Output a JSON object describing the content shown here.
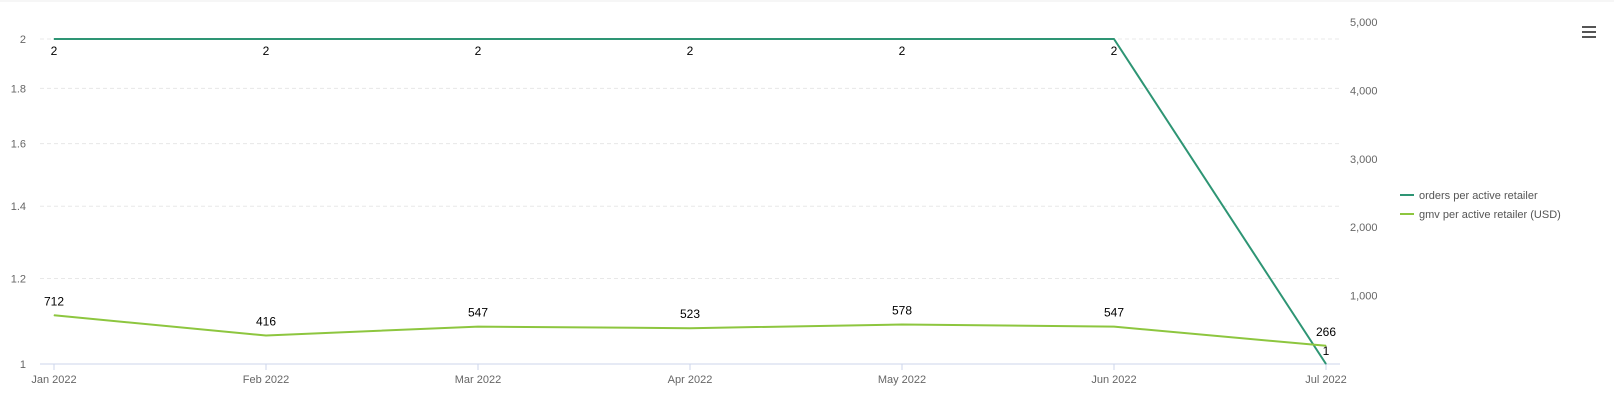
{
  "chart_data": {
    "type": "line",
    "categories": [
      "Jan 2022",
      "Feb 2022",
      "Mar 2022",
      "Apr 2022",
      "May 2022",
      "Jun 2022",
      "Jul 2022"
    ],
    "series": [
      {
        "name": "orders per active retailer",
        "axis": "left",
        "color": "#2e9574",
        "values": [
          2,
          2,
          2,
          2,
          2,
          2,
          1
        ],
        "labels": [
          "2",
          "2",
          "2",
          "2",
          "2",
          "2",
          "1"
        ]
      },
      {
        "name": "gmv per active retailer (USD)",
        "axis": "right",
        "color": "#8dc63f",
        "values": [
          712,
          416,
          547,
          523,
          578,
          547,
          266
        ],
        "labels": [
          "712",
          "416",
          "547",
          "523",
          "578",
          "547",
          "266"
        ]
      }
    ],
    "y_left": {
      "scale": "log",
      "ylim": [
        1,
        2
      ],
      "ticks": [
        1,
        1.2,
        1.4,
        1.6,
        1.8,
        2
      ],
      "tick_labels": [
        "1",
        "1.2",
        "1.4",
        "1.6",
        "1.8",
        "2"
      ]
    },
    "y_right": {
      "scale": "linear",
      "ylim": [
        0,
        5000
      ],
      "ticks": [
        1000,
        2000,
        3000,
        4000,
        5000
      ],
      "tick_labels": [
        "1,000",
        "2,000",
        "3,000",
        "4,000",
        "5,000"
      ]
    },
    "legend_position": "right",
    "grid": true
  },
  "menu_icon": "hamburger-menu-icon"
}
